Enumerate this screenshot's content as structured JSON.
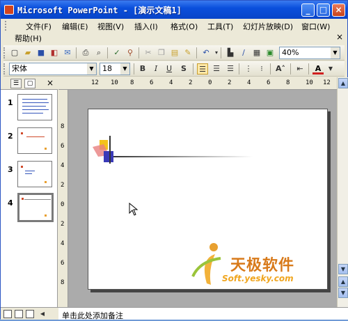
{
  "window": {
    "title": "Microsoft PowerPoint - [演示文稿1]"
  },
  "menu": {
    "items": [
      "文件(F)",
      "编辑(E)",
      "视图(V)",
      "插入(I)",
      "格式(O)",
      "工具(T)",
      "幻灯片放映(D)",
      "窗口(W)",
      "帮助(H)"
    ]
  },
  "format_toolbar": {
    "font": "宋体",
    "size": "18",
    "bold": "B",
    "italic": "I",
    "underline": "U",
    "shadow": "S"
  },
  "standard_toolbar": {
    "zoom": "40%"
  },
  "outline_tabs": {
    "close": "×"
  },
  "thumbnails": [
    {
      "num": "1"
    },
    {
      "num": "2"
    },
    {
      "num": "3"
    },
    {
      "num": "4",
      "selected": true
    }
  ],
  "ruler": {
    "top": [
      "12",
      "10",
      "8",
      "6",
      "4",
      "2",
      "0",
      "2",
      "4",
      "6",
      "8",
      "10",
      "12"
    ],
    "left": [
      "8",
      "6",
      "4",
      "2",
      "0",
      "2",
      "4",
      "6",
      "8"
    ]
  },
  "notes": {
    "text": "单击此处添加备注"
  },
  "watermark": {
    "brand": "天极软件",
    "url": "Soft.yesky.com"
  },
  "icons": [
    "app-icon",
    "minimize-icon",
    "maximize-icon",
    "close-icon",
    "new-icon",
    "open-icon",
    "save-icon",
    "print-icon",
    "cursor-icon"
  ]
}
